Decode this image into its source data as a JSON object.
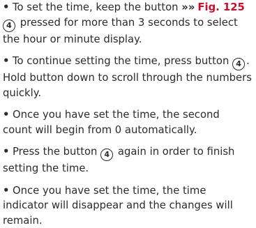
{
  "items": [
    {
      "before": "To set the time, keep the button",
      "ref_arrow": "»»",
      "ref_fig": "Fig. 125",
      "circled": "4",
      "after": "pressed for more than 3 seconds to select the hour or minute display."
    },
    {
      "before": "To continue setting the time, press button",
      "circled": "4",
      "after": ". Hold button down to scroll through the numbers quickly."
    },
    {
      "text": "Once you have set the time, the second count will begin from 0 automatically."
    },
    {
      "before": "Press the button",
      "circled": "4",
      "after": "again in order to finish setting the time."
    },
    {
      "text": "Once you have set the time, the time indicator will disappear and the changes will remain."
    }
  ]
}
